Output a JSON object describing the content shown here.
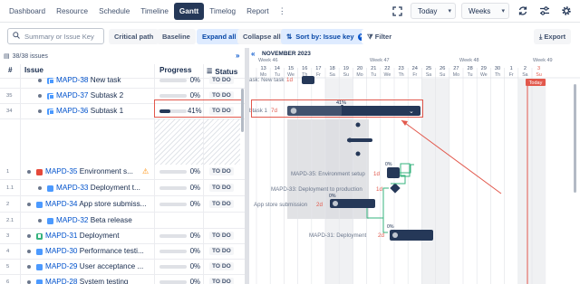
{
  "nav": {
    "tabs": [
      {
        "label": "Dashboard",
        "active": false
      },
      {
        "label": "Resource",
        "active": false
      },
      {
        "label": "Schedule",
        "active": false
      },
      {
        "label": "Timeline",
        "active": false
      },
      {
        "label": "Gantt",
        "active": true
      },
      {
        "label": "Timelog",
        "active": false
      },
      {
        "label": "Report",
        "active": false
      }
    ],
    "more_icon": "⋮",
    "today_label": "Today",
    "scale_label": "Weeks"
  },
  "toolbar": {
    "search_placeholder": "Summary or Issue Key",
    "critical_path": "Critical path",
    "baseline": "Baseline",
    "expand_all": "Expand all",
    "collapse_all": "Collapse all",
    "sort_by": "Sort by: Issue key",
    "filter": "Filter",
    "export": "Export"
  },
  "grid": {
    "issue_count": "38/38 issues",
    "col_num": "#",
    "col_issue": "Issue",
    "col_progress": "Progress",
    "col_status": "Status"
  },
  "rows": [
    {
      "num": "",
      "key": "MAPD-38",
      "title": "New task",
      "pct": "0%",
      "progress": 0,
      "status": "TO DO",
      "icon": "subtask",
      "indent": 2
    },
    {
      "num": "35",
      "key": "MAPD-37",
      "title": "Subtask 2",
      "pct": "0%",
      "progress": 0,
      "status": "TO DO",
      "icon": "subtask",
      "indent": 2
    },
    {
      "num": "34",
      "key": "MAPD-36",
      "title": "Subtask 1",
      "pct": "41%",
      "progress": 41,
      "status": "TO DO",
      "icon": "subtask",
      "indent": 2
    },
    {
      "num": "1",
      "key": "MAPD-35",
      "title": "Environment s...",
      "pct": "0%",
      "progress": 0,
      "status": "TO DO",
      "icon": "bug",
      "indent": 1,
      "warning": true
    },
    {
      "num": "1.1",
      "key": "MAPD-33",
      "title": "Deployment t...",
      "pct": "0%",
      "progress": 0,
      "status": "TO DO",
      "icon": "task",
      "indent": 2
    },
    {
      "num": "2",
      "key": "MAPD-34",
      "title": "App store submiss...",
      "pct": "0%",
      "progress": 0,
      "status": "TO DO",
      "icon": "task",
      "indent": 1
    },
    {
      "num": "2.1",
      "key": "MAPD-32",
      "title": "Beta release",
      "pct": "",
      "progress": null,
      "status": "",
      "icon": "task",
      "indent": 2
    },
    {
      "num": "3",
      "key": "MAPD-31",
      "title": "Deployment",
      "pct": "0%",
      "progress": 0,
      "status": "TO DO",
      "icon": "story",
      "indent": 1
    },
    {
      "num": "4",
      "key": "MAPD-30",
      "title": "Performance testi...",
      "pct": "0%",
      "progress": 0,
      "status": "TO DO",
      "icon": "task",
      "indent": 1
    },
    {
      "num": "5",
      "key": "MAPD-29",
      "title": "User acceptance ...",
      "pct": "0%",
      "progress": 0,
      "status": "TO DO",
      "icon": "task",
      "indent": 1
    },
    {
      "num": "6",
      "key": "MAPD-28",
      "title": "System testing",
      "pct": "0%",
      "progress": 0,
      "status": "TO DO",
      "icon": "task",
      "indent": 1
    }
  ],
  "timeline": {
    "month": "NOVEMBER 2023",
    "weeks": [
      "Week 46",
      "Week 47",
      "Week 48",
      "Week 49"
    ],
    "dates": [
      "13",
      "14",
      "15",
      "16",
      "17",
      "18",
      "19",
      "20",
      "21",
      "22",
      "23",
      "24",
      "25",
      "26",
      "27",
      "28",
      "29",
      "30",
      "1",
      "2",
      "3"
    ],
    "weekdays": [
      "Mo",
      "Tu",
      "We",
      "Th",
      "Fr",
      "Sa",
      "Su",
      "Mo",
      "Tu",
      "We",
      "Th",
      "Fr",
      "Sa",
      "Su",
      "Mo",
      "Tu",
      "We",
      "Th",
      "Fr",
      "Sa",
      "Su"
    ],
    "today_label": "Today",
    "bar_labels": {
      "new_task": "New task",
      "new_task_days": "1d",
      "subtask1": "Subtask 1",
      "subtask1_days": "7d",
      "subtask1_pct": "41%",
      "env": "MAPD-35: Environment setup",
      "env_days": "1d",
      "env_pct": "0%",
      "deploy_prod": "MAPD-33: Deployment to production",
      "deploy_prod_days": "1d",
      "app_store": "App store submission",
      "app_store_days": "2d",
      "app_store_pct": "0%",
      "deploy": "MAPD-31: Deployment",
      "deploy_days": "2d",
      "deploy_pct": "0%"
    }
  },
  "colors": {
    "accent": "#253858",
    "link": "#0052cc",
    "today": "#e2584c",
    "dependency": "#36b37e",
    "bar": "#253858"
  }
}
